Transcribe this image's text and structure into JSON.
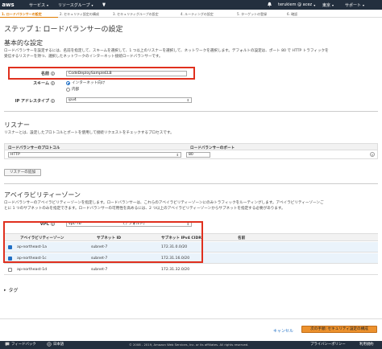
{
  "topnav": {
    "logo": "aws",
    "services": "サービス",
    "resource_groups": "リソースグループ",
    "user": "terukiem @ acez",
    "region": "東京",
    "support": "サポート"
  },
  "steps": [
    {
      "label": "1. ロードバランサーの設定",
      "active": true
    },
    {
      "label": "2. セキュリティ設定の構成",
      "active": false
    },
    {
      "label": "3. セキュリティグループの設定",
      "active": false
    },
    {
      "label": "4. ルーティングの設定",
      "active": false
    },
    {
      "label": "5. ターゲットの登録",
      "active": false
    },
    {
      "label": "6. 確認",
      "active": false
    }
  ],
  "page_title": "ステップ 1: ロードバランサーの設定",
  "basic": {
    "heading": "基本的な設定",
    "description_line1": "ロードバランサーを設定するには、名前を指定して、スキームを選択して、1 つ以上のリスナーを選択して、ネットワークを選択します。デフォルトの設定は、ポート 80 で HTTP トラフィックを",
    "description_line2": "受信するリスナーを持つ、選択したネットワークのインターネット接続ロードバランサーです。",
    "name_label": "名前",
    "name_value": "CodeDeploySampleELB",
    "scheme_label": "スキーム",
    "scheme_options": [
      {
        "label": "インターネット向け",
        "selected": true
      },
      {
        "label": "内部",
        "selected": false
      }
    ],
    "ip_label": "IP アドレスタイプ",
    "ip_value": "ipv4"
  },
  "listeners": {
    "heading": "リスナー",
    "description": "リスナーとは、設定したプロトコルとポートを使用して接続リクエストをチェックするプロセスです。",
    "col_protocol": "ロードバランサーのプロトコル",
    "col_port": "ロードバランサーのポート",
    "rows": [
      {
        "protocol": "HTTP",
        "port": "80"
      }
    ],
    "add_button": "リスナーの追加"
  },
  "az": {
    "heading": "アベイラビリティーゾーン",
    "description_line1": "ロードバランサーのアベイラビリティーゾーンを指定します。ロードバランサーは、これらのアベイラビリティーゾーンにのみトラフィックをルーティングします。アベイラビリティーゾーンご",
    "description_line2": "とに 1 つのサブネットのみを指定できます。ロードバランサーの可用性を高めるには、2 つ以上のアベイラビリティーゾーンからサブネットを指定する必要があります。",
    "vpc_label": "VPC",
    "vpc_value": "vpc-7b",
    "vpc_default": "(デフォルト)",
    "col_az": "アベイラビリティーゾーン",
    "col_subnet": "サブネット ID",
    "col_cidr": "サブネット IPv4 CIDR",
    "col_name": "名前",
    "rows": [
      {
        "az": "ap-northeast-1a",
        "subnet": "subnet-7",
        "cidr": "172.31.0.0/20",
        "checked": true
      },
      {
        "az": "ap-northeast-1c",
        "subnet": "subnet-7",
        "cidr": "172.31.16.0/20",
        "checked": true
      },
      {
        "az": "ap-northeast-1d",
        "subnet": "subnet-7",
        "cidr": "172.31.32.0/20",
        "checked": false
      }
    ]
  },
  "tags": {
    "label": "タグ"
  },
  "actions": {
    "cancel": "キャンセル",
    "next": "次の手順: セキュリティ設定の構成"
  },
  "footer": {
    "feedback": "フィードバック",
    "language": "日本語",
    "copyright": "© 2008 - 2019, Amazon Web Services, Inc. or its affiliates. All rights reserved.",
    "privacy": "プライバシーポリシー",
    "terms": "利用規約"
  },
  "colors": {
    "nav": "#232f3e",
    "accent": "#e07b00",
    "highlight": "#e0301e",
    "primary_button": "#ec912d"
  }
}
